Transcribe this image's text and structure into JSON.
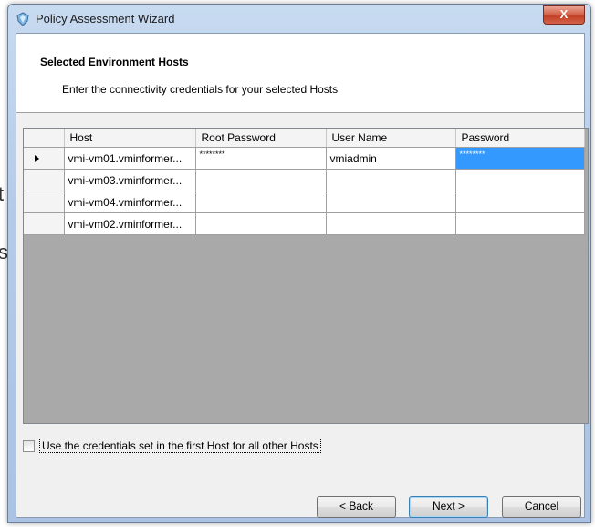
{
  "background": {
    "glyph_top": "t",
    "glyph_bottom": "s"
  },
  "window": {
    "title": "Policy Assessment Wizard",
    "close_label": "X"
  },
  "header": {
    "title": "Selected Environment Hosts",
    "subtitle": "Enter the connectivity credentials for your selected Hosts"
  },
  "grid": {
    "columns": [
      "Host",
      "Root Password",
      "User Name",
      "Password"
    ],
    "rows": [
      {
        "host": "vmi-vm01.vminformer...",
        "root_password": "********",
        "user_name": "vmiadmin",
        "password": "********",
        "current": true
      },
      {
        "host": "vmi-vm03.vminformer...",
        "root_password": "",
        "user_name": "",
        "password": "",
        "current": false
      },
      {
        "host": "vmi-vm04.vminformer...",
        "root_password": "",
        "user_name": "",
        "password": "",
        "current": false
      },
      {
        "host": "vmi-vm02.vminformer...",
        "root_password": "",
        "user_name": "",
        "password": "",
        "current": false
      }
    ]
  },
  "options": {
    "use_first_host_label": "Use the credentials set in the first Host for all other Hosts",
    "use_first_host_checked": false
  },
  "buttons": {
    "back": "< Back",
    "next": "Next >",
    "cancel": "Cancel"
  },
  "colors": {
    "selection": "#3399ff",
    "grid_background": "#a9a9a9"
  }
}
